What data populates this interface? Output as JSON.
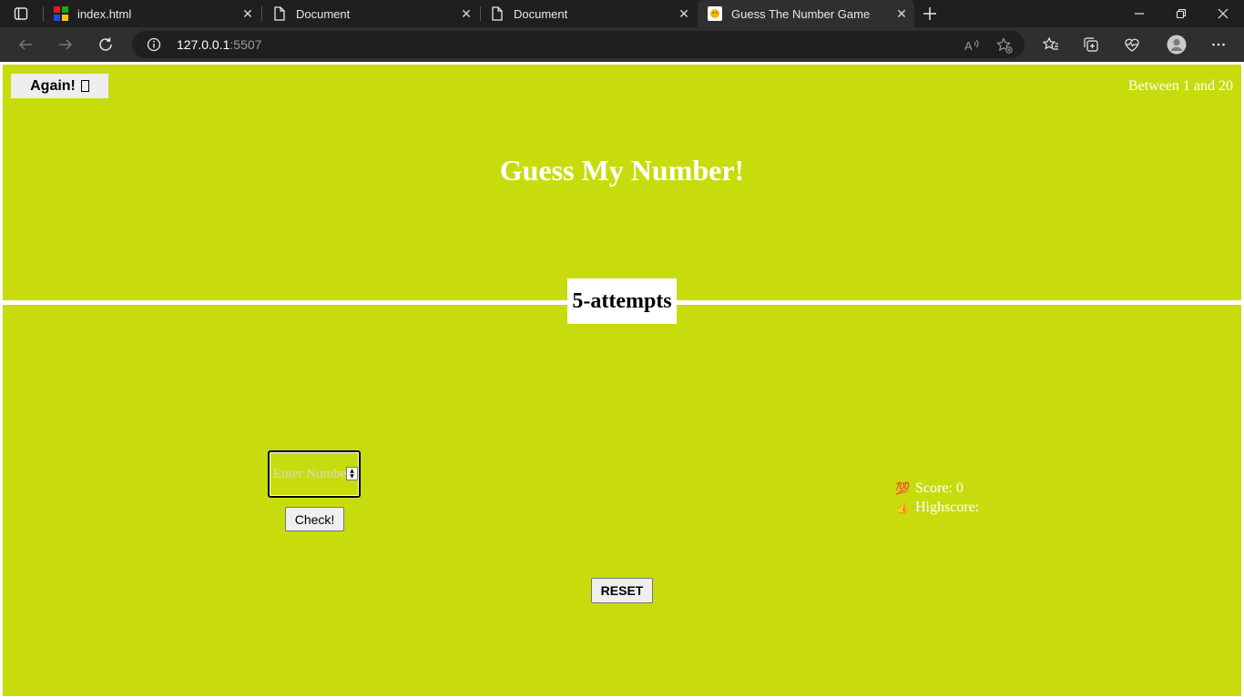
{
  "browser": {
    "tabs": [
      {
        "title": "index.html",
        "icon": "colorful-grid-icon",
        "active": false
      },
      {
        "title": "Document",
        "icon": "document-icon",
        "active": false
      },
      {
        "title": "Document",
        "icon": "document-icon",
        "active": false
      },
      {
        "title": "Guess The Number Game",
        "icon": "game-favicon",
        "active": true
      }
    ],
    "url_host": "127.0.0.1",
    "url_port": ":5507",
    "colors": {
      "tabbar": "#1f1f1f",
      "toolbar": "#2f2f2f",
      "accent": "#c8dc0d"
    }
  },
  "game": {
    "again_label": "Again!",
    "range_text": "Between 1 and 20",
    "title": "Guess My Number!",
    "attempts_label": "5-attempts",
    "input_placeholder": "Enter Number",
    "check_label": "Check!",
    "reset_label": "RESET",
    "score_emoji": "💯",
    "score_label": "Score: 0",
    "highscore_emoji": "👍",
    "highscore_label": "Highscore:",
    "background_color": "#c8dc0d"
  }
}
